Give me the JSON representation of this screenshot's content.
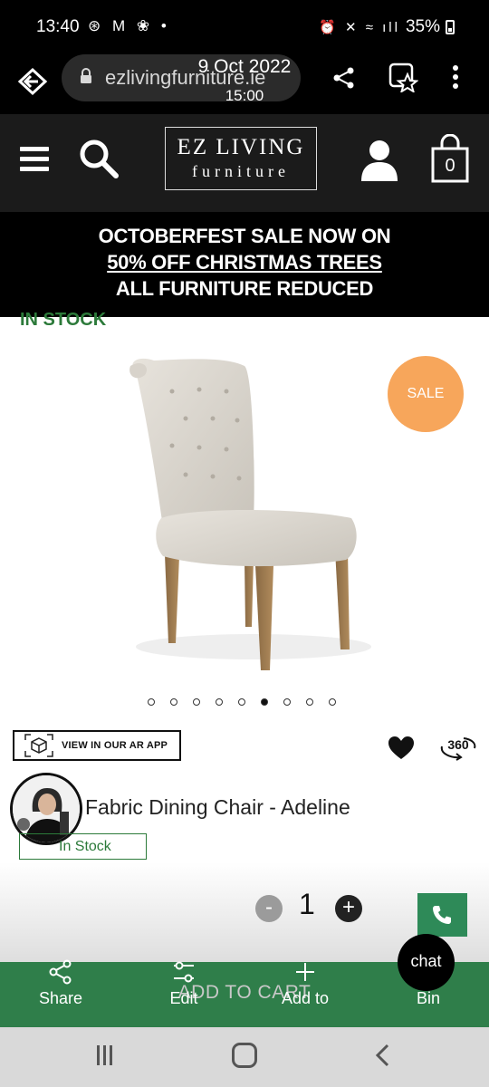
{
  "status_bar": {
    "time": "13:40",
    "left_icons": "⊛ M ❀ •",
    "right_icons": "⏰ ✕ ≈ ıll",
    "battery": "35%"
  },
  "browser": {
    "url": "ezlivingfurniture.ie",
    "overlay_date": "9 Oct 2022",
    "overlay_time": "15:00"
  },
  "header": {
    "logo_line1": "EZ LIVING",
    "logo_line2": "furniture",
    "cart_count": "0"
  },
  "promo": {
    "line1": "OCTOBERFEST SALE NOW ON",
    "line2": "50% OFF CHRISTMAS TREES",
    "line3": "ALL FURNITURE REDUCED"
  },
  "product": {
    "stock_top": "IN STOCK",
    "sale_badge": "SALE",
    "image_count": 9,
    "active_image_index": 5,
    "ar_button_label": "VIEW IN OUR AR APP",
    "rotate_label": "360",
    "title": "Fabric Dining Chair - Adeline",
    "stock_status": "In Stock",
    "quantity": "1",
    "minus_symbol": "-",
    "plus_symbol": "+"
  },
  "cart": {
    "add_to_cart_label": "ADD TO CART",
    "brand_green": "#2f7e4a"
  },
  "overlay_actions": {
    "share": "Share",
    "edit": "Edit",
    "add_to": "Add to",
    "bin": "Bin",
    "chat": "chat"
  }
}
